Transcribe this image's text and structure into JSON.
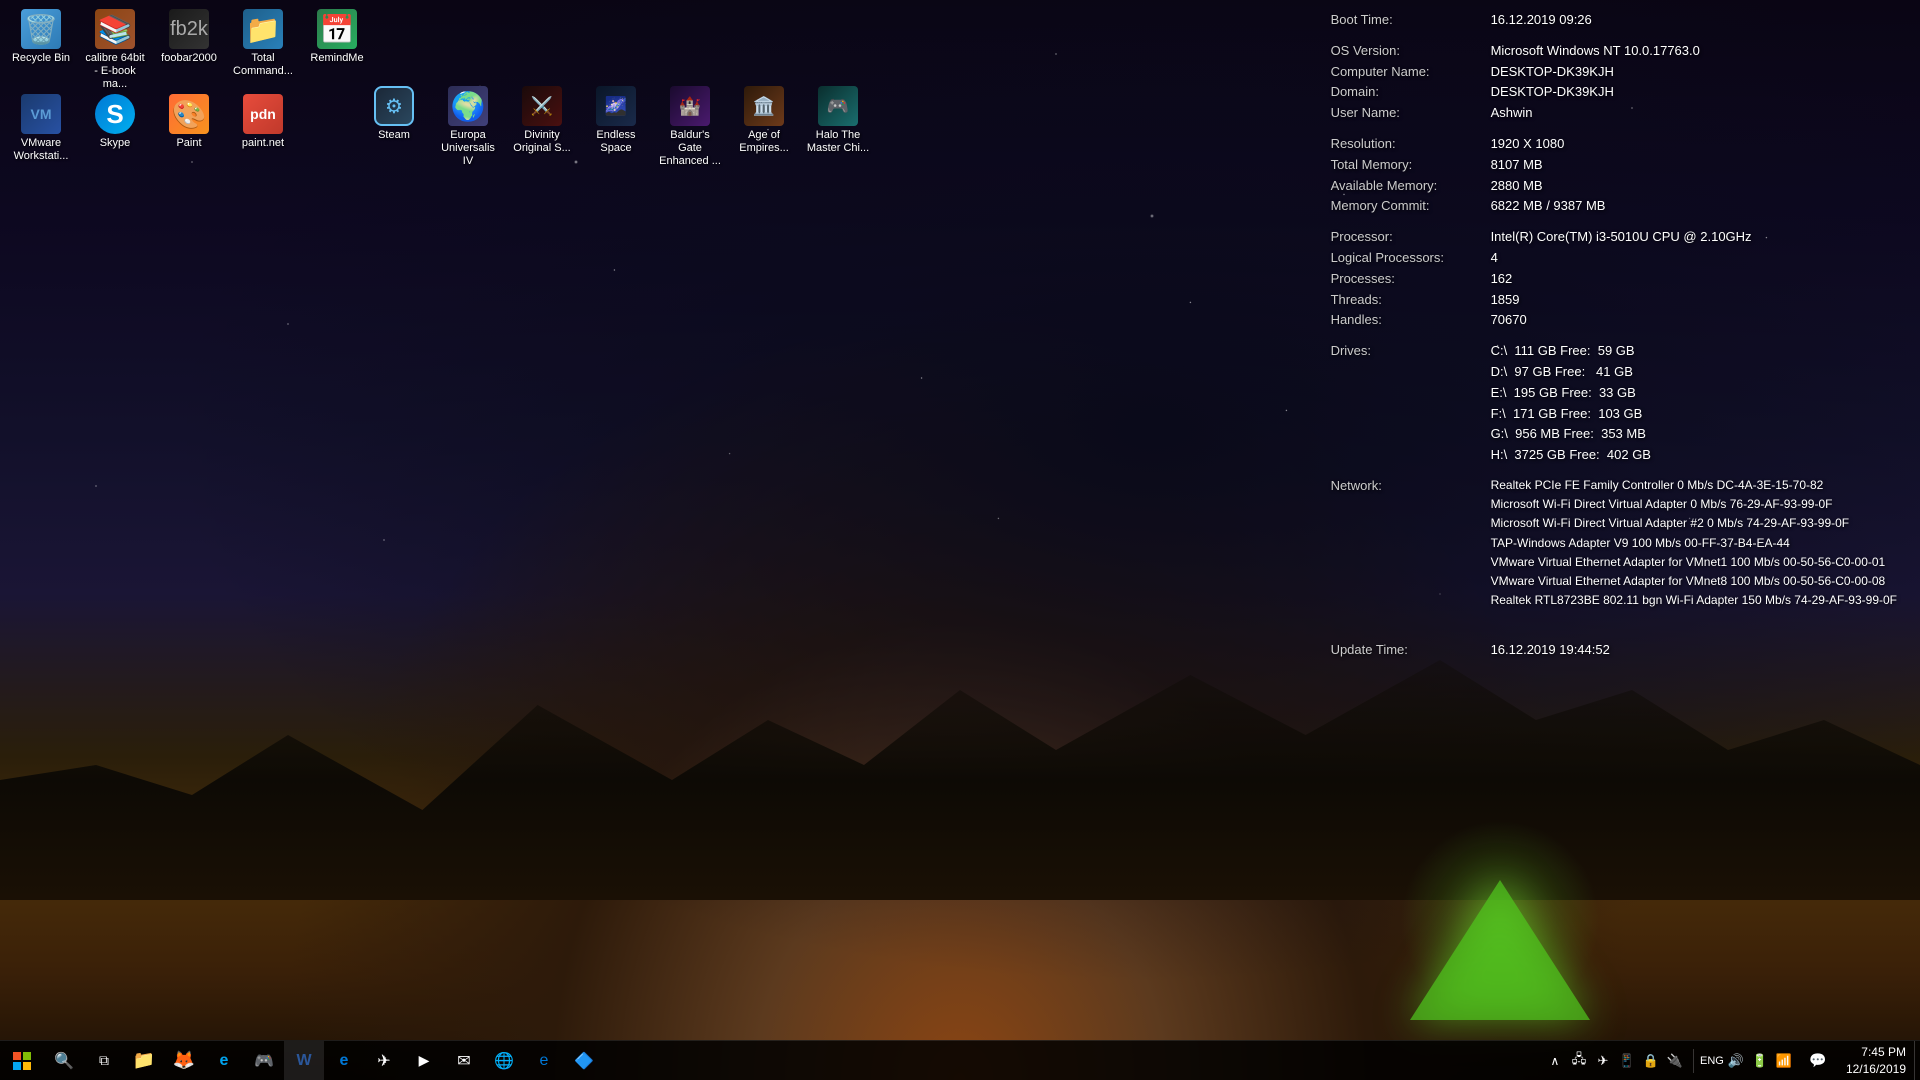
{
  "desktop": {
    "wallpaper": "mountain-night-scene"
  },
  "icons_row1": [
    {
      "id": "recycle-bin",
      "label": "Recycle Bin",
      "icon": "🗑️",
      "style": "recycle"
    },
    {
      "id": "calibre",
      "label": "calibre 64bit - E-book ma...",
      "icon": "📚",
      "style": "calibre"
    },
    {
      "id": "foobar",
      "label": "foobar2000",
      "icon": "🎵",
      "style": "foobar"
    },
    {
      "id": "total-commander",
      "label": "Total Command...",
      "icon": "📁",
      "style": "total"
    },
    {
      "id": "remindme",
      "label": "RemindMe",
      "icon": "📅",
      "style": "remind"
    }
  ],
  "icons_row2": [
    {
      "id": "vmware",
      "label": "VMware Workstati...",
      "icon": "🖥️",
      "style": "vmware"
    },
    {
      "id": "skype",
      "label": "Skype",
      "icon": "S",
      "style": "skype"
    },
    {
      "id": "paint",
      "label": "Paint",
      "icon": "🎨",
      "style": "paint-app"
    },
    {
      "id": "paintnet",
      "label": "paint.net",
      "icon": "🖌️",
      "style": "paintnet"
    }
  ],
  "icons_row3": [
    {
      "id": "steam",
      "label": "Steam",
      "icon": "⚙",
      "style": "steam"
    },
    {
      "id": "europa",
      "label": "Europa Universalis IV",
      "icon": "🌍",
      "style": "europa"
    },
    {
      "id": "divinity",
      "label": "Divinity Original S...",
      "icon": "⚔️",
      "style": "divinity"
    },
    {
      "id": "endless",
      "label": "Endless Space",
      "icon": "🌌",
      "style": "endless"
    },
    {
      "id": "baldur",
      "label": "Baldur's Gate Enhanced ...",
      "icon": "🏰",
      "style": "baldur"
    },
    {
      "id": "age",
      "label": "Age of Empires...",
      "icon": "🏛️",
      "style": "age"
    },
    {
      "id": "halo",
      "label": "Halo The Master Chi...",
      "icon": "🎮",
      "style": "halo"
    }
  ],
  "sysinfo": {
    "boot_time_label": "Boot Time:",
    "boot_time_value": "16.12.2019 09:26",
    "os_version_label": "OS Version:",
    "os_version_value": "Microsoft Windows NT 10.0.17763.0",
    "computer_name_label": "Computer Name:",
    "computer_name_value": "DESKTOP-DK39KJH",
    "domain_label": "Domain:",
    "domain_value": "DESKTOP-DK39KJH",
    "user_name_label": "User Name:",
    "user_name_value": "Ashwin",
    "resolution_label": "Resolution:",
    "resolution_value": "1920 X 1080",
    "total_memory_label": "Total Memory:",
    "total_memory_value": "8107 MB",
    "available_memory_label": "Available Memory:",
    "available_memory_value": "2880 MB",
    "memory_commit_label": "Memory Commit:",
    "memory_commit_value": "6822 MB / 9387 MB",
    "processor_label": "Processor:",
    "processor_value": "Intel(R) Core(TM) i3-5010U CPU @ 2.10GHz",
    "logical_processors_label": "Logical Processors:",
    "logical_processors_value": "4",
    "processes_label": "Processes:",
    "processes_value": "162",
    "threads_label": "Threads:",
    "threads_value": "1859",
    "handles_label": "Handles:",
    "handles_value": "70670",
    "drives_label": "Drives:",
    "drives": [
      {
        "drive": "C:\\",
        "size": "111 GB Free:",
        "free": "59 GB"
      },
      {
        "drive": "D:\\",
        "size": "97 GB Free:",
        "free": "41 GB"
      },
      {
        "drive": "E:\\",
        "size": "195 GB Free:",
        "free": "33 GB"
      },
      {
        "drive": "F:\\",
        "size": "171 GB Free:",
        "free": "103 GB"
      },
      {
        "drive": "G:\\",
        "size": "956 MB Free:",
        "free": "353 MB"
      },
      {
        "drive": "H:\\",
        "size": "3725 GB Free:",
        "free": "402 GB"
      }
    ],
    "network_label": "Network:",
    "network": [
      "Realtek PCIe FE Family Controller 0 Mb/s DC-4A-3E-15-70-82",
      "Microsoft Wi-Fi Direct Virtual Adapter 0 Mb/s 76-29-AF-93-99-0F",
      "Microsoft Wi-Fi Direct Virtual Adapter #2 0 Mb/s 74-29-AF-93-99-0F",
      "TAP-Windows Adapter V9 100 Mb/s 00-FF-37-B4-EA-44",
      "VMware Virtual Ethernet Adapter for VMnet1 100 Mb/s 00-50-56-C0-00-01",
      "VMware Virtual Ethernet Adapter for VMnet8 100 Mb/s 00-50-56-C0-00-08",
      "Realtek RTL8723BE 802.11 bgn Wi-Fi Adapter 150 Mb/s 74-29-AF-93-99-0F"
    ],
    "update_time_label": "Update Time:",
    "update_time_value": "16.12.2019 19:44:52"
  },
  "taskbar": {
    "start_icon": "⊞",
    "clock_time": "7:45 PM",
    "clock_date": "12/16/2019",
    "taskbar_apps": [
      {
        "id": "file-explorer-taskbar",
        "icon": "📁"
      },
      {
        "id": "firefox-taskbar",
        "icon": "🦊"
      },
      {
        "id": "ie-taskbar",
        "icon": "e"
      },
      {
        "id": "app3-taskbar",
        "icon": "🎮"
      },
      {
        "id": "word-taskbar",
        "icon": "W"
      },
      {
        "id": "edge-taskbar",
        "icon": "e"
      },
      {
        "id": "telegram-taskbar",
        "icon": "✈"
      },
      {
        "id": "media-taskbar",
        "icon": "▶"
      },
      {
        "id": "mail-taskbar",
        "icon": "✉"
      },
      {
        "id": "browser2-taskbar",
        "icon": "🌐"
      },
      {
        "id": "edgenew-taskbar",
        "icon": "e"
      },
      {
        "id": "app4-taskbar",
        "icon": "🔷"
      }
    ]
  }
}
